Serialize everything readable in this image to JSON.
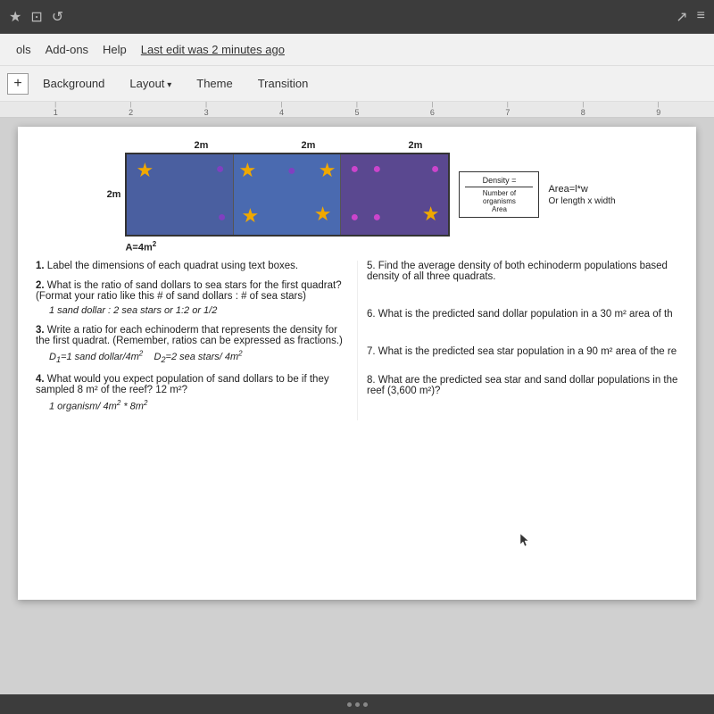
{
  "browser": {
    "icons": [
      "★",
      "⊡",
      "↺"
    ]
  },
  "menu": {
    "items": [
      "ols",
      "Add-ons",
      "Help"
    ],
    "last_edit": "Last edit was 2 minutes ago",
    "nav_icons": [
      "↗",
      "≡"
    ]
  },
  "toolbar": {
    "add_label": "+",
    "buttons": [
      "Background",
      "Layout",
      "Theme",
      "Transition"
    ]
  },
  "ruler": {
    "marks": [
      "1",
      "2",
      "3",
      "4",
      "5",
      "6",
      "7",
      "8",
      "9"
    ]
  },
  "diagram": {
    "top_labels": [
      "2m",
      "2m",
      "2m"
    ],
    "side_label": "2m",
    "area_label": "A=4m²",
    "density_text": "Density =",
    "density_formula": "Number of organisms / Area",
    "area_formula": "Area=l*w",
    "area_formula2": "Or length x width"
  },
  "questions": {
    "q1": "Label the dimensions of each quadrat using text boxes.",
    "q2": "What is the ratio of sand dollars to sea stars for the first quadrat? (Format your ratio like this # of sand dollars : # of sea stars)",
    "q2_answer": "1 sand dollar : 2 sea stars or 1:2 or 1/2",
    "q3": "Write a ratio for each echinoderm that represents the density for the first quadrat. (Remember, ratios can be expressed as fractions.)",
    "q3_answer1": "D₁=1 sand dollar/4m²",
    "q3_answer2": "D₂=2 sea stars/ 4m²",
    "q4": "What would you expect population of sand dollars to be if they sampled 8 m² of the reef? 12 m²?",
    "q4_answer": "1 organism/ 4m² * 8m²",
    "q5": "5. Find the average density of both echinoderm populations based density of all three quadrats.",
    "q6": "6. What is the predicted sand dollar population in a 30 m² area of th",
    "q7": "7. What is the predicted sea star population in a 90 m² area of the re",
    "q8": "8. What are the predicted sea star and sand dollar populations in the reef (3,600 m²)?"
  }
}
